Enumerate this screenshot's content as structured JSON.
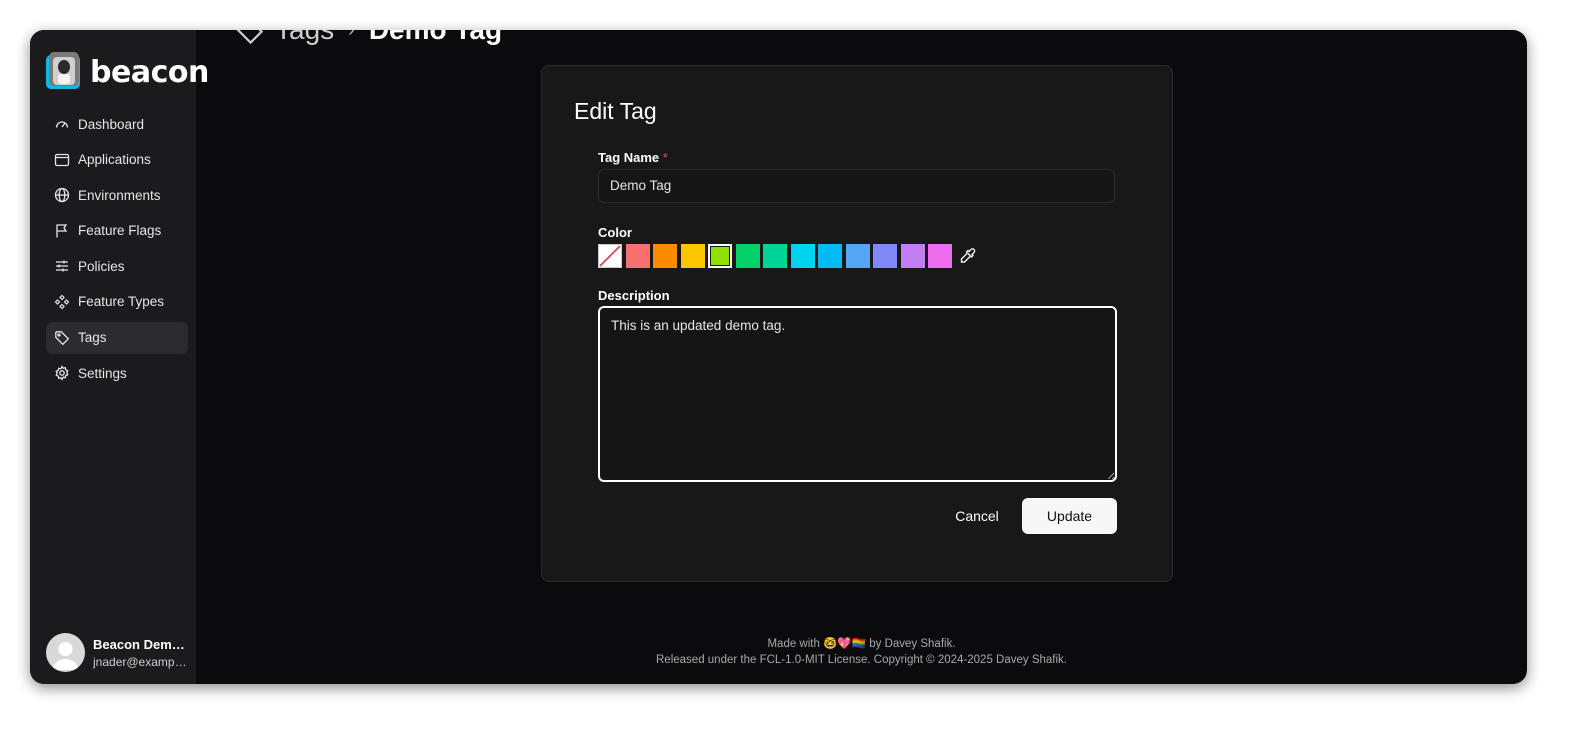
{
  "app": {
    "brand": "beacon"
  },
  "breadcrumb": {
    "parent": "Tags",
    "separator": "›",
    "current": "Demo Tag"
  },
  "sidebar": {
    "items": [
      {
        "label": "Dashboard",
        "icon": "gauge-icon"
      },
      {
        "label": "Applications",
        "icon": "window-icon"
      },
      {
        "label": "Environments",
        "icon": "globe-icon"
      },
      {
        "label": "Feature Flags",
        "icon": "flag-icon"
      },
      {
        "label": "Policies",
        "icon": "sliders-icon"
      },
      {
        "label": "Feature Types",
        "icon": "components-icon"
      },
      {
        "label": "Tags",
        "icon": "tag-icon",
        "active": true
      },
      {
        "label": "Settings",
        "icon": "gear-icon"
      }
    ]
  },
  "user": {
    "name": "Beacon Demo…",
    "email": "jnader@exampl…"
  },
  "form": {
    "title": "Edit Tag",
    "name_label": "Tag Name",
    "required_mark": "*",
    "name_value": "Demo Tag",
    "color_label": "Color",
    "colors": [
      "none",
      "#f87171",
      "#fb8c00",
      "#fbc500",
      "#8fe000",
      "#00d26a",
      "#00d494",
      "#00d3ef",
      "#00bbf4",
      "#55a6f7",
      "#8089f8",
      "#c17ef5",
      "#ee6cf0"
    ],
    "selected_color": "#8fe000",
    "description_label": "Description",
    "description_value": "This is an updated demo tag.",
    "cancel_label": "Cancel",
    "update_label": "Update"
  },
  "footer": {
    "line1": "Made with 🤓💖🏳️‍🌈 by Davey Shafik.",
    "line2": "Released under the FCL-1.0-MIT License. Copyright © 2024-2025 Davey Shafik."
  }
}
